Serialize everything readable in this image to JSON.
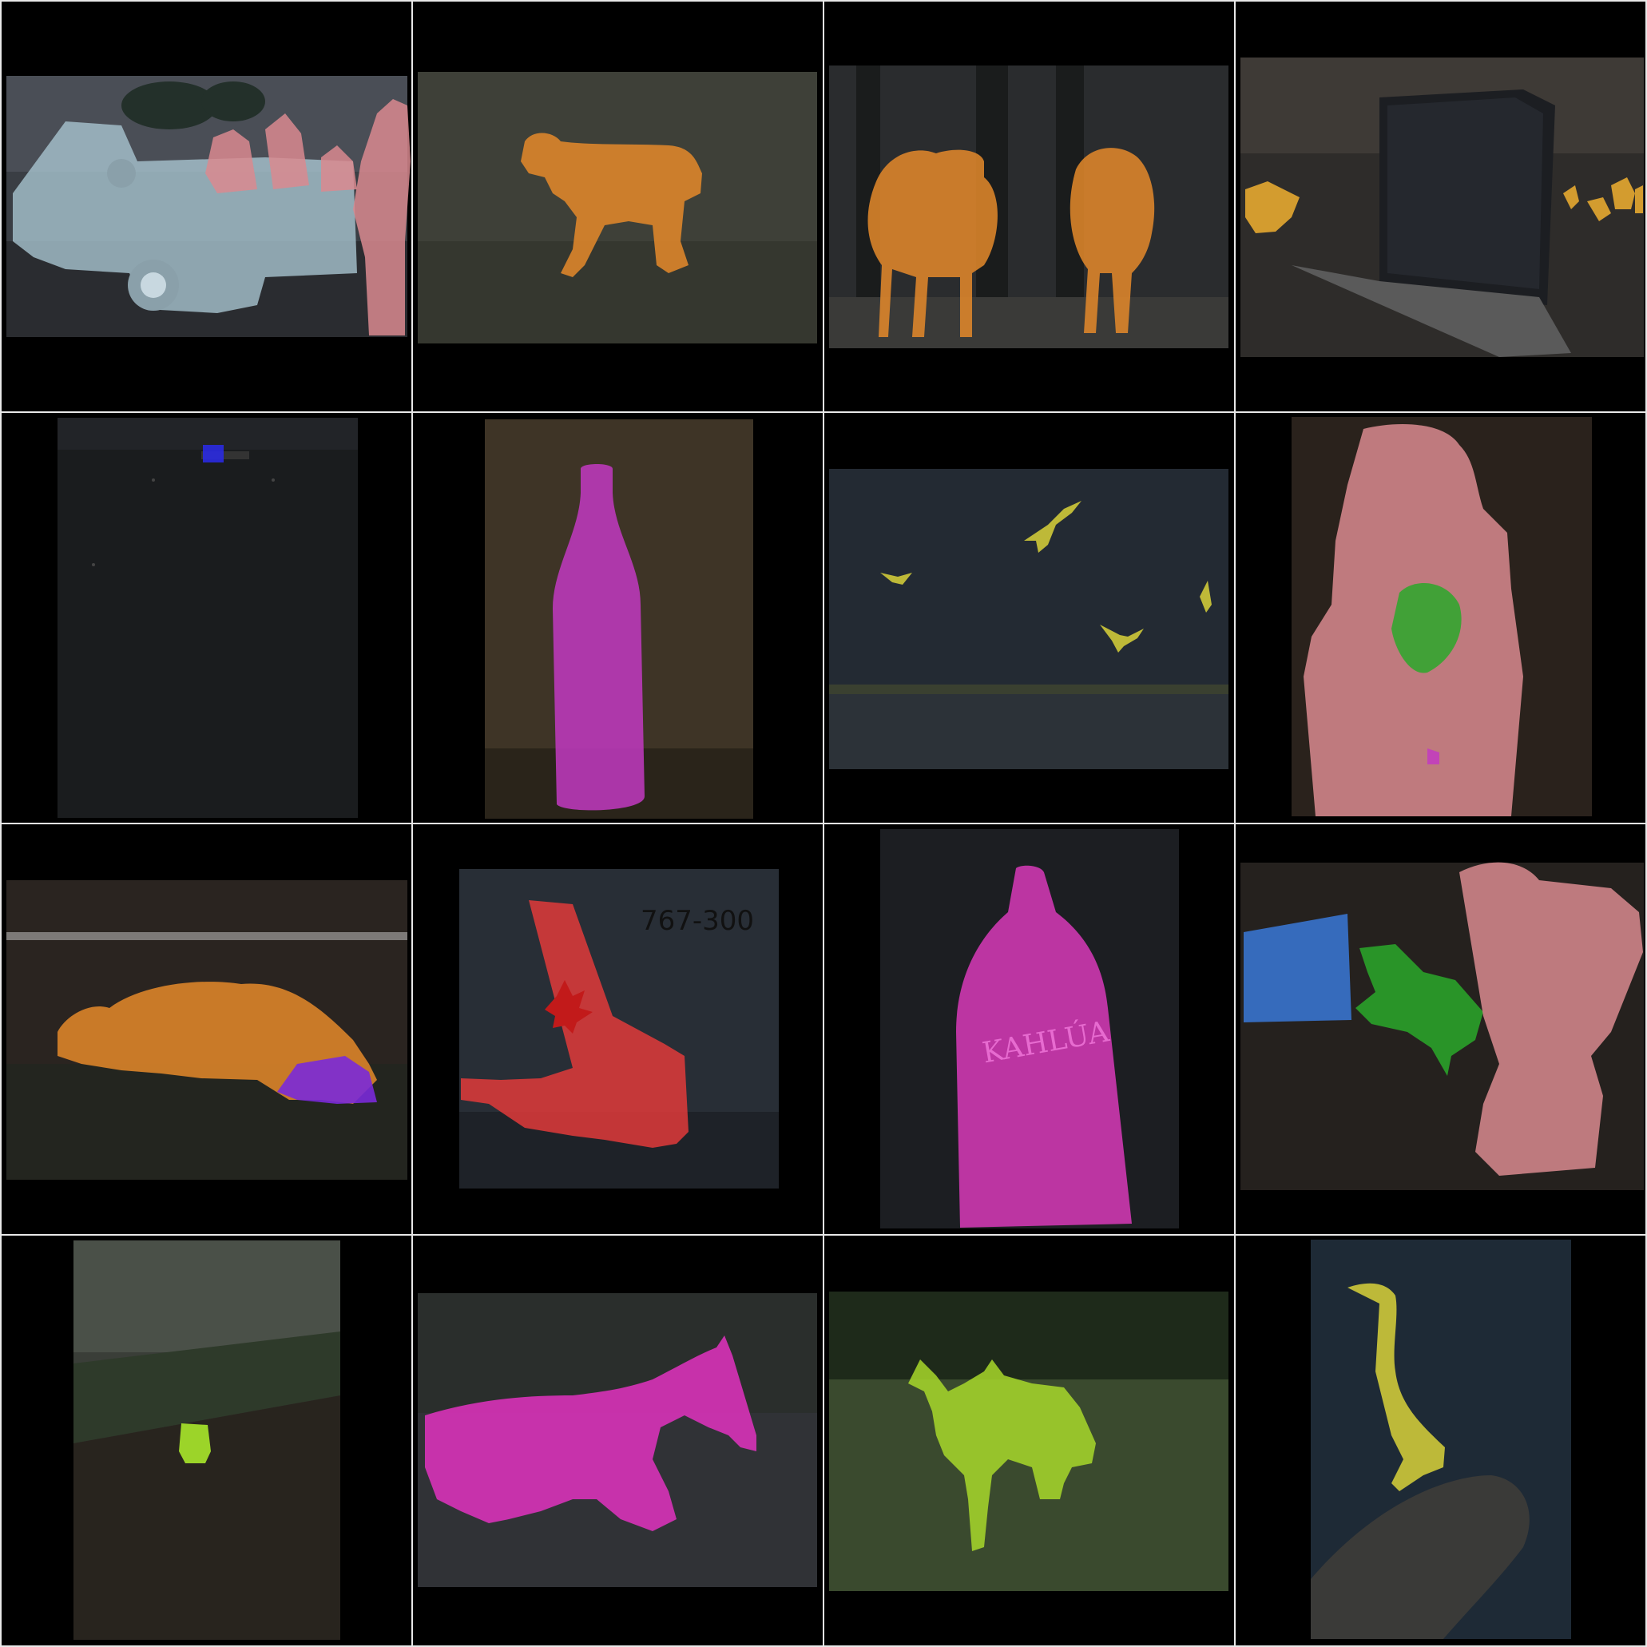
{
  "colors": {
    "background": "#000000",
    "divider": "#e8e8e8",
    "person": "#d98a8f",
    "sheep": "#e58a2a",
    "bottle": "#c23ac2",
    "bird": "#d9d23a",
    "plant": "#2aa82a",
    "monitor": "#3a78d8",
    "cow": "#a8d82a",
    "horse": "#d832b8",
    "airplane": "#e03a3a",
    "boat": "#2a2ae0",
    "food": "#f0b030",
    "train": "#a8e82a"
  },
  "panels": [
    {
      "key": "pickup-truck-people",
      "overlay_text": ""
    },
    {
      "key": "lamb-grass",
      "overlay_text": ""
    },
    {
      "key": "two-sheep",
      "overlay_text": ""
    },
    {
      "key": "laptop-table",
      "overlay_text": ""
    },
    {
      "key": "boat-dark-water",
      "overlay_text": ""
    },
    {
      "key": "bottle-table",
      "overlay_text": ""
    },
    {
      "key": "birds-sky",
      "overlay_text": ""
    },
    {
      "key": "girl-flowers",
      "overlay_text": ""
    },
    {
      "key": "sheep-lying",
      "overlay_text": ""
    },
    {
      "key": "airplane-tail",
      "overlay_text": "767-300"
    },
    {
      "key": "kahlua-bottle",
      "overlay_text": ""
    },
    {
      "key": "man-plant-monitor",
      "overlay_text": ""
    },
    {
      "key": "train-valley",
      "overlay_text": ""
    },
    {
      "key": "horse",
      "overlay_text": ""
    },
    {
      "key": "cow-field",
      "overlay_text": ""
    },
    {
      "key": "heron-log",
      "overlay_text": ""
    }
  ]
}
